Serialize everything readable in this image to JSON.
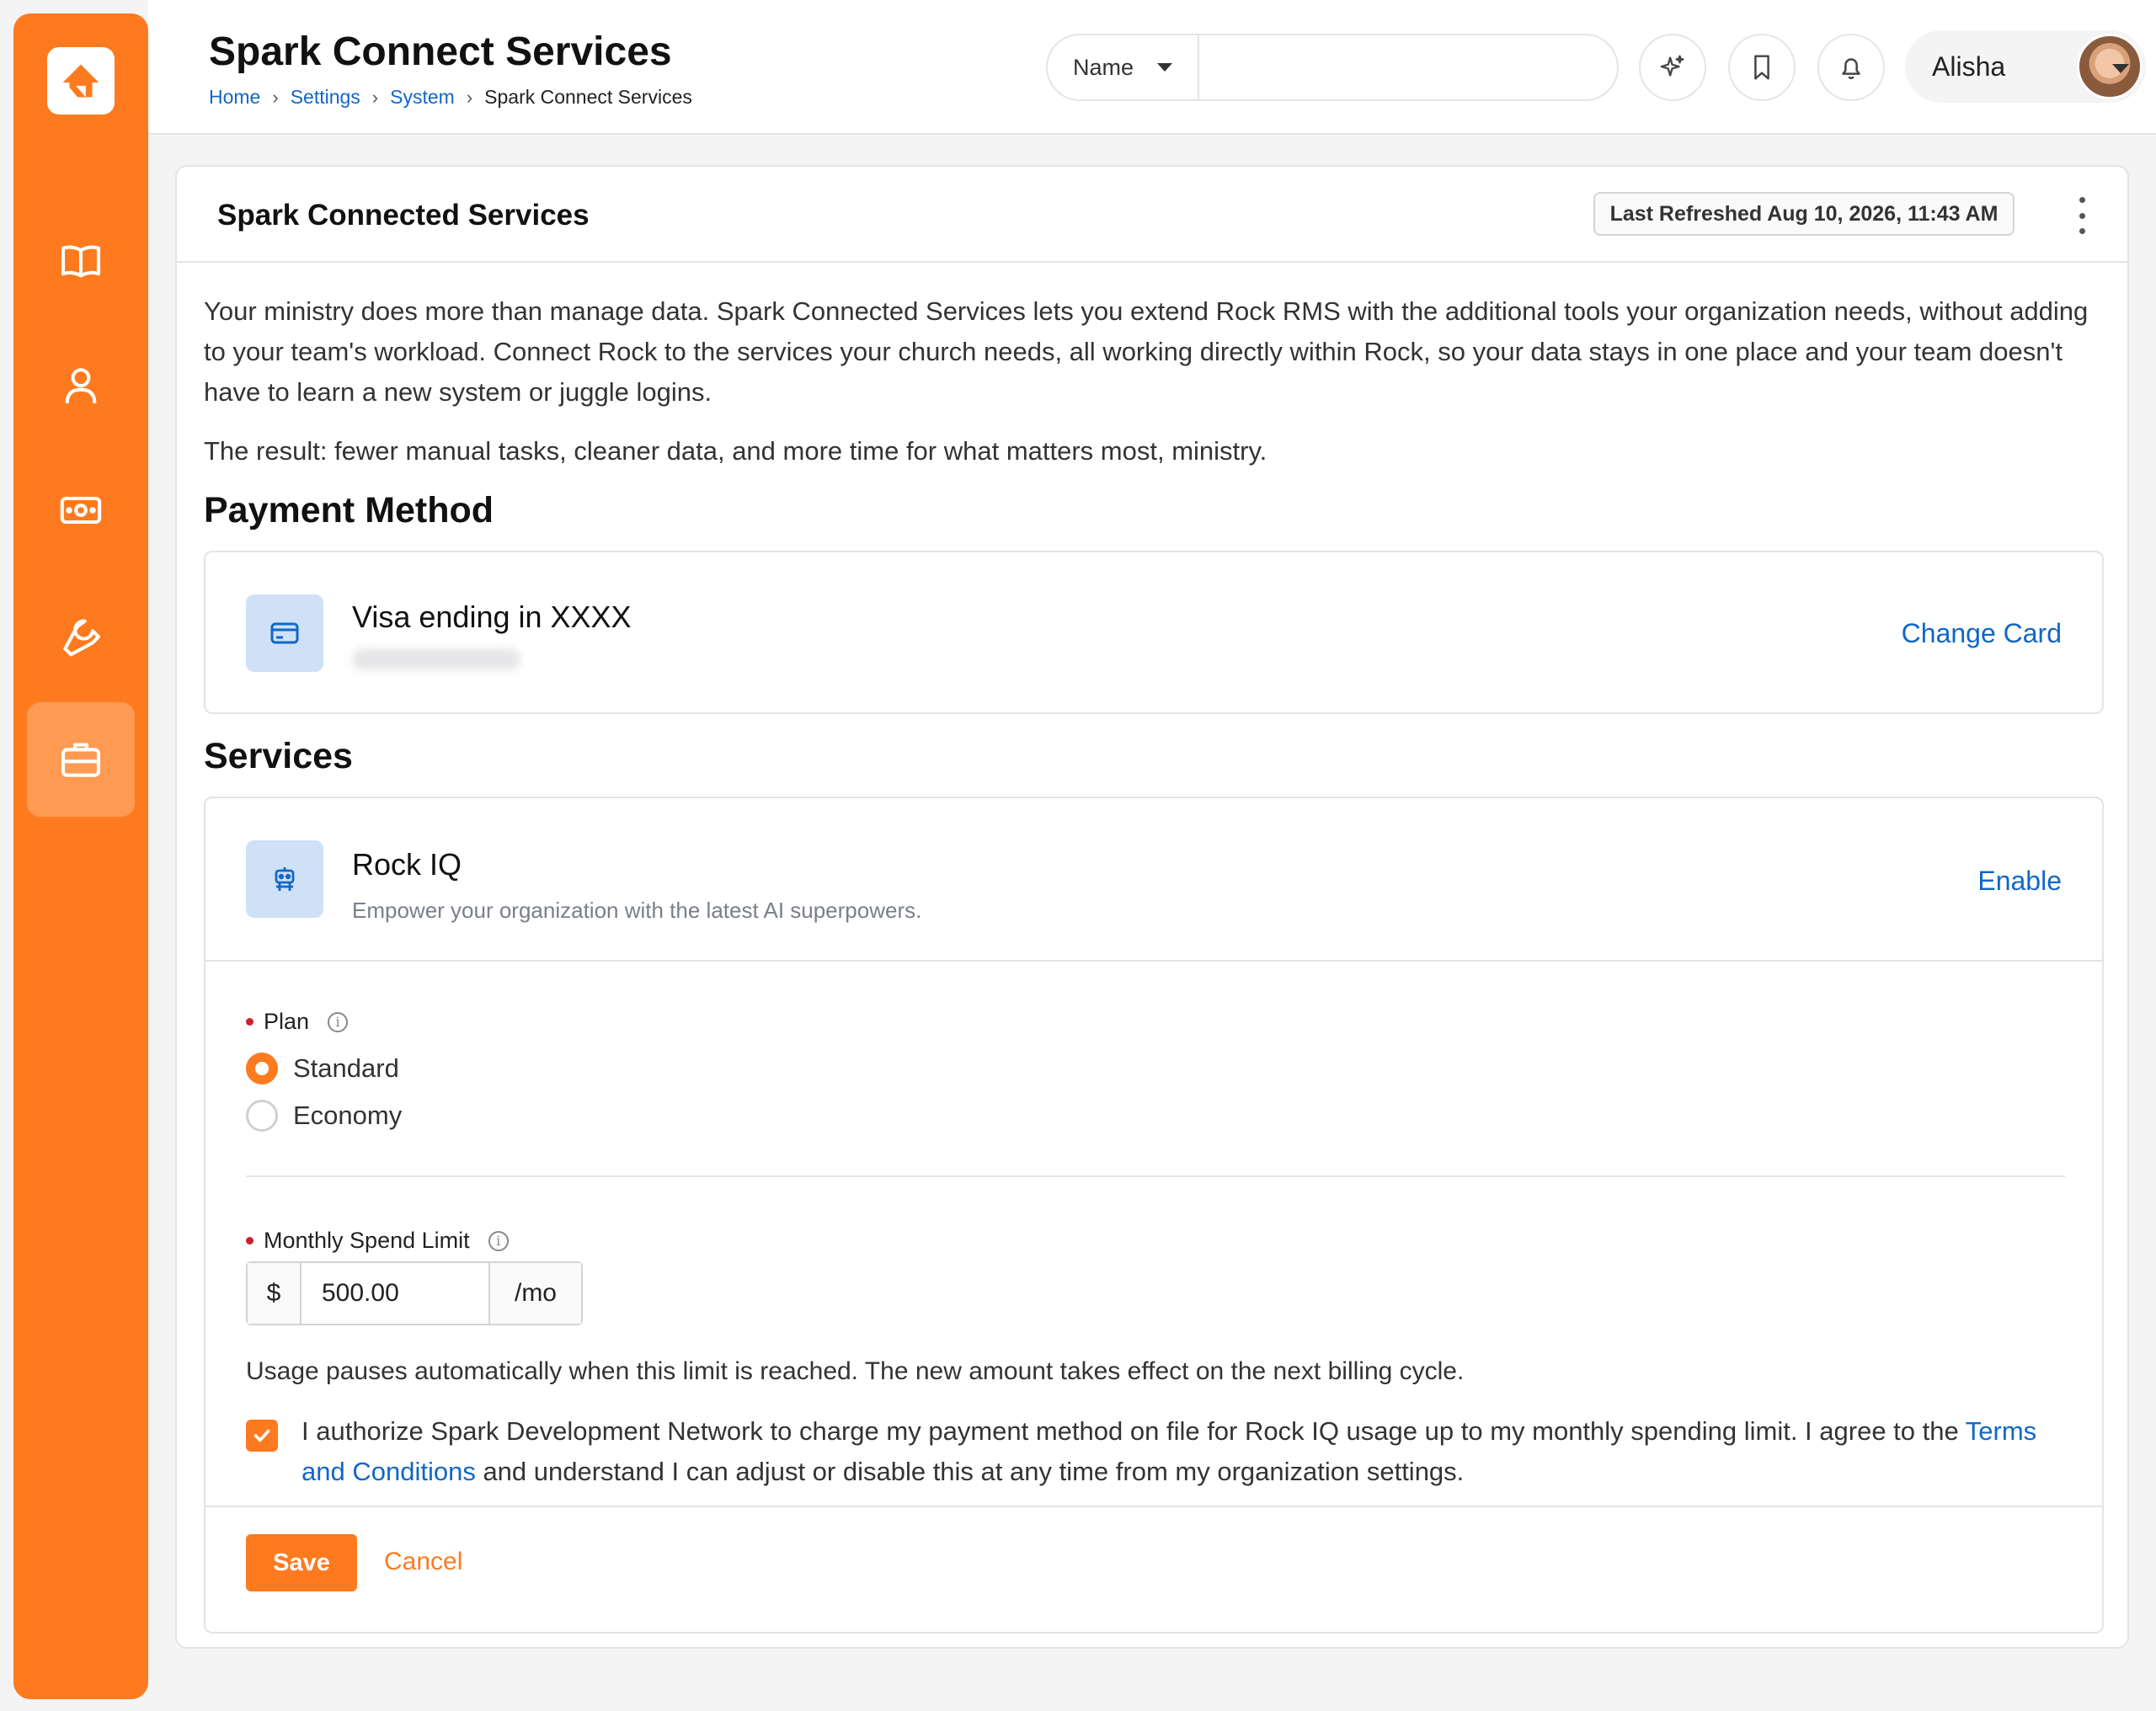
{
  "sidebar": {
    "logo_icon": "rock-logo-icon",
    "items": [
      {
        "icon": "book-icon"
      },
      {
        "icon": "person-icon"
      },
      {
        "icon": "cash-icon"
      },
      {
        "icon": "wrench-icon"
      },
      {
        "icon": "briefcase-icon",
        "active": true
      }
    ],
    "accent": "#fe7a1f"
  },
  "header": {
    "title": "Spark Connect Services",
    "breadcrumb": [
      "Home",
      "Settings",
      "System",
      "Spark Connect Services"
    ],
    "search": {
      "select_value": "Name",
      "placeholder": ""
    },
    "user_name": "Alisha"
  },
  "card": {
    "title": "Spark Connected Services",
    "last_refreshed": "Last Refreshed Aug 10, 2026, 11:43 AM",
    "intro_1": "Your ministry does more than manage data. Spark Connected Services lets you extend Rock RMS with the additional tools your organization needs, without adding to your team's workload. Connect Rock to the services your church needs, all working directly within Rock, so your data stays in one place and your team doesn't have to learn a new system or juggle logins.",
    "intro_2": "The result: fewer manual tasks, cleaner data, and more time for what matters most, ministry."
  },
  "payment": {
    "section_title": "Payment Method",
    "card_label": "Visa ending in XXXX",
    "change_label": "Change Card"
  },
  "services": {
    "section_title": "Services",
    "service_name": "Rock IQ",
    "service_desc": "Empower your organization with the latest AI superpowers.",
    "enable_label": "Enable",
    "plan_label": "Plan",
    "plan_options": [
      "Standard",
      "Economy"
    ],
    "plan_selected": "Standard",
    "limit_label": "Monthly Spend Limit",
    "limit_prefix": "$",
    "limit_value": "500.00",
    "limit_suffix": "/mo",
    "limit_help": "Usage pauses automatically when this limit is reached. The new amount takes effect on the next billing cycle.",
    "consent_before": "I authorize Spark Development Network to charge my payment method on file for Rock IQ usage up to my monthly spending limit. I agree to the ",
    "consent_link": "Terms and Conditions",
    "consent_after": " and understand I can adjust or disable this at any time from my organization settings.",
    "consent_checked": true
  },
  "actions": {
    "save_label": "Save",
    "cancel_label": "Cancel"
  }
}
